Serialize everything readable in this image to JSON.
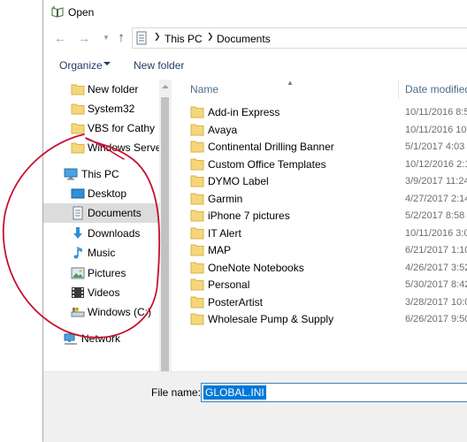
{
  "window": {
    "title": "Open"
  },
  "address": {
    "crumbs": [
      "This PC",
      "Documents"
    ]
  },
  "toolbar": {
    "organize_label": "Organize",
    "new_folder_label": "New folder"
  },
  "nav": {
    "items": [
      {
        "label": "New folder",
        "icon": "folder-icon"
      },
      {
        "label": "System32",
        "icon": "folder-icon"
      },
      {
        "label": "VBS for Cathy",
        "icon": "folder-icon"
      },
      {
        "label": "Windows Server",
        "icon": "folder-icon"
      },
      {
        "label": "This PC",
        "icon": "computer-icon"
      },
      {
        "label": "Desktop",
        "icon": "desktop-icon"
      },
      {
        "label": "Documents",
        "icon": "documents-icon",
        "selected": true
      },
      {
        "label": "Downloads",
        "icon": "downloads-icon"
      },
      {
        "label": "Music",
        "icon": "music-icon"
      },
      {
        "label": "Pictures",
        "icon": "pictures-icon"
      },
      {
        "label": "Videos",
        "icon": "videos-icon"
      },
      {
        "label": "Windows (C:)",
        "icon": "drive-icon"
      },
      {
        "label": "Network",
        "icon": "network-icon"
      }
    ]
  },
  "columns": {
    "name": "Name",
    "date_modified": "Date modified"
  },
  "files": [
    {
      "name": "Add-in Express",
      "date": "10/11/2016 8:5"
    },
    {
      "name": "Avaya",
      "date": "10/11/2016 10:"
    },
    {
      "name": "Continental Drilling Banner",
      "date": "5/1/2017 4:03 P"
    },
    {
      "name": "Custom Office Templates",
      "date": "10/12/2016 2:1"
    },
    {
      "name": "DYMO Label",
      "date": "3/9/2017 11:24"
    },
    {
      "name": "Garmin",
      "date": "4/27/2017 2:14"
    },
    {
      "name": "iPhone 7 pictures",
      "date": "5/2/2017 8:58 A"
    },
    {
      "name": "IT Alert",
      "date": "10/11/2016 3:0"
    },
    {
      "name": "MAP",
      "date": "6/21/2017 1:10"
    },
    {
      "name": "OneNote Notebooks",
      "date": "4/26/2017 3:52"
    },
    {
      "name": "Personal",
      "date": "5/30/2017 8:42"
    },
    {
      "name": "PosterArtist",
      "date": "3/28/2017 10:0"
    },
    {
      "name": "Wholesale Pump & Supply",
      "date": "6/26/2017 9:50"
    }
  ],
  "file_name": {
    "label": "File name:",
    "value": "GLOBAL.INI"
  },
  "colors": {
    "folder": "#f5d67b",
    "accent": "#0078d7",
    "annotation": "#c8102e"
  }
}
